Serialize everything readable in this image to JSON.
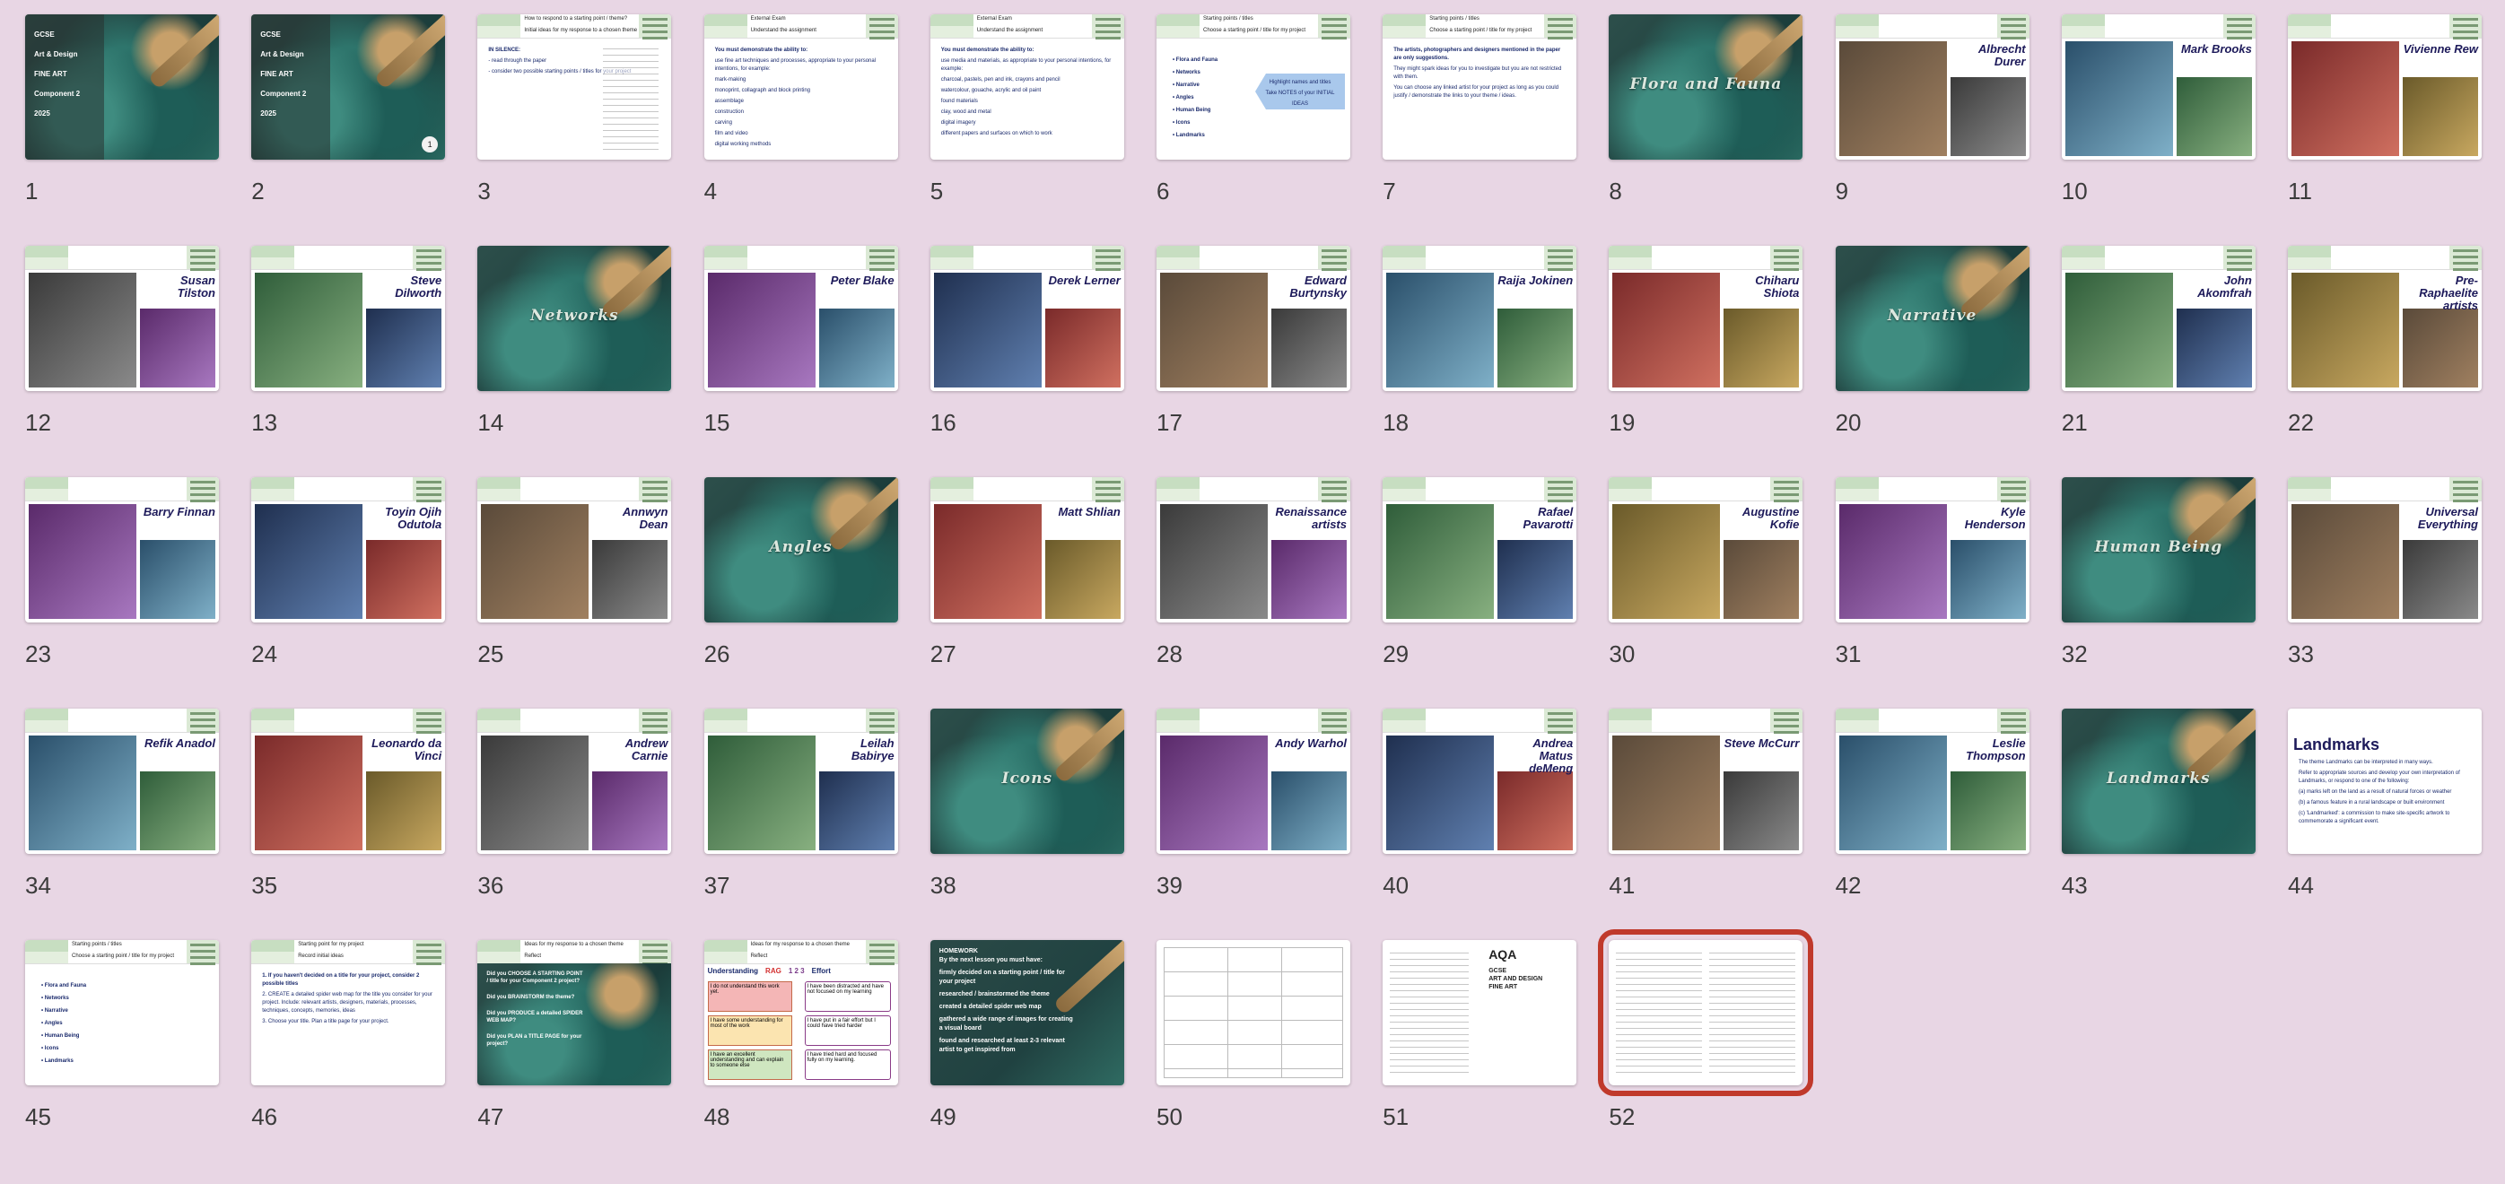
{
  "slides": [
    {
      "n": "1",
      "type": "cover-intro",
      "lines": [
        "GCSE",
        "Art & Design",
        "FINE ART",
        "Component 2",
        "2025"
      ]
    },
    {
      "n": "2",
      "type": "cover-intro",
      "lines": [
        "GCSE",
        "Art & Design",
        "FINE ART",
        "Component 2",
        "2025"
      ],
      "badge": "1"
    },
    {
      "n": "3",
      "type": "text",
      "header": [
        "How to respond to a starting point / theme?",
        "Initial ideas for my response to a chosen theme"
      ],
      "body": [
        "IN SILENCE:",
        "- read through the paper",
        "- consider two possible starting points / titles for your project"
      ]
    },
    {
      "n": "4",
      "type": "text",
      "header": [
        "External Exam",
        "Understand the assignment"
      ],
      "body": [
        "You must demonstrate the ability to:",
        "use fine art techniques and processes, appropriate to your personal intentions, for example:",
        "mark-making",
        "monoprint, collagraph and block printing",
        "assemblage",
        "construction",
        "carving",
        "film and video",
        "digital working methods"
      ]
    },
    {
      "n": "5",
      "type": "text",
      "header": [
        "External Exam",
        "Understand the assignment"
      ],
      "body": [
        "You must demonstrate the ability to:",
        "use media and materials, as appropriate to your personal intentions, for example:",
        "charcoal, pastels, pen and ink, crayons and pencil",
        "watercolour, gouache, acrylic and oil paint",
        "found materials",
        "clay, wood and metal",
        "digital imagery",
        "different papers and surfaces on which to work"
      ]
    },
    {
      "n": "6",
      "type": "list",
      "header": [
        "Starting points / titles",
        "Choose a starting point / title for my project"
      ],
      "items": [
        "Flora and Fauna",
        "Networks",
        "Narrative",
        "Angles",
        "Human Being",
        "Icons",
        "Landmarks"
      ],
      "callout": [
        "Highlight names and titles",
        "Take NOTES of your INITIAL IDEAS"
      ]
    },
    {
      "n": "7",
      "type": "text",
      "header": [
        "Starting points / titles",
        "Choose a starting point / title for my project"
      ],
      "body": [
        "The artists, photographers and designers mentioned in the paper are only suggestions.",
        "They might spark ideas for you to investigate but you are not restricted with them.",
        "You can choose any linked artist for your project as long as you could justify / demonstrate the links to your theme / ideas."
      ]
    },
    {
      "n": "8",
      "type": "cover",
      "title": "Flora and Fauna"
    },
    {
      "n": "9",
      "type": "artist",
      "artist": "Albrecht Durer"
    },
    {
      "n": "10",
      "type": "artist",
      "artist": "Mark Brooks"
    },
    {
      "n": "11",
      "type": "artist",
      "artist": "Vivienne Rew"
    },
    {
      "n": "12",
      "type": "artist",
      "artist": "Susan Tilston"
    },
    {
      "n": "13",
      "type": "artist",
      "artist": "Steve Dilworth"
    },
    {
      "n": "14",
      "type": "cover",
      "title": "Networks"
    },
    {
      "n": "15",
      "type": "artist",
      "artist": "Peter Blake"
    },
    {
      "n": "16",
      "type": "artist",
      "artist": "Derek Lerner"
    },
    {
      "n": "17",
      "type": "artist",
      "artist": "Edward Burtynsky"
    },
    {
      "n": "18",
      "type": "artist",
      "artist": "Raija Jokinen"
    },
    {
      "n": "19",
      "type": "artist",
      "artist": "Chiharu Shiota"
    },
    {
      "n": "20",
      "type": "cover",
      "title": "Narrative"
    },
    {
      "n": "21",
      "type": "artist",
      "artist": "John Akomfrah"
    },
    {
      "n": "22",
      "type": "artist",
      "artist": "Pre-Raphaelite artists"
    },
    {
      "n": "23",
      "type": "artist",
      "artist": "Barry Finnan"
    },
    {
      "n": "24",
      "type": "artist",
      "artist": "Toyin Ojih Odutola"
    },
    {
      "n": "25",
      "type": "artist",
      "artist": "Annwyn Dean"
    },
    {
      "n": "26",
      "type": "cover",
      "title": "Angles"
    },
    {
      "n": "27",
      "type": "artist",
      "artist": "Matt Shlian"
    },
    {
      "n": "28",
      "type": "artist",
      "artist": "Renaissance artists"
    },
    {
      "n": "29",
      "type": "artist",
      "artist": "Rafael Pavarotti"
    },
    {
      "n": "30",
      "type": "artist",
      "artist": "Augustine Kofie"
    },
    {
      "n": "31",
      "type": "artist",
      "artist": "Kyle Henderson"
    },
    {
      "n": "32",
      "type": "cover",
      "title": "Human Being"
    },
    {
      "n": "33",
      "type": "artist",
      "artist": "Universal Everything"
    },
    {
      "n": "34",
      "type": "artist",
      "artist": "Refik Anadol"
    },
    {
      "n": "35",
      "type": "artist",
      "artist": "Leonardo da Vinci"
    },
    {
      "n": "36",
      "type": "artist",
      "artist": "Andrew Carnie"
    },
    {
      "n": "37",
      "type": "artist",
      "artist": "Leilah Babirye"
    },
    {
      "n": "38",
      "type": "cover",
      "title": "Icons"
    },
    {
      "n": "39",
      "type": "artist",
      "artist": "Andy Warhol"
    },
    {
      "n": "40",
      "type": "artist",
      "artist": "Andrea Matus deMeng"
    },
    {
      "n": "41",
      "type": "artist",
      "artist": "Steve McCurr"
    },
    {
      "n": "42",
      "type": "artist",
      "artist": "Leslie Thompson"
    },
    {
      "n": "43",
      "type": "cover",
      "title": "Landmarks"
    },
    {
      "n": "44",
      "type": "landmarks",
      "title": "Landmarks",
      "body": [
        "The theme Landmarks can be interpreted in many ways.",
        "Refer to appropriate sources and develop your own interpretation of Landmarks, or respond to one of the following:",
        "(a) marks left on the land as a result of natural forces or weather",
        "(b) a famous feature in a rural landscape or built environment",
        "(c) 'Landmarked': a commission to make site-specific artwork to commemorate a significant event."
      ]
    },
    {
      "n": "45",
      "type": "list",
      "header": [
        "Starting points / titles",
        "Choose a starting point / title for my project"
      ],
      "items": [
        "Flora and Fauna",
        "Networks",
        "Narrative",
        "Angles",
        "Human Being",
        "Icons",
        "Landmarks"
      ]
    },
    {
      "n": "46",
      "type": "text",
      "header": [
        "Starting point for my project",
        "Record initial ideas"
      ],
      "body": [
        "1. If you haven't decided on a title for your project, consider 2 possible titles",
        "2. CREATE a detailed spider web map for the title you consider for your project. Include: relevant artists, designers, materials, processes, techniques, concepts, memories, ideas",
        "3. Choose your title. Plan a title page for your project."
      ]
    },
    {
      "n": "47",
      "type": "questions",
      "header": [
        "Ideas for my response to a chosen theme",
        "Reflect"
      ],
      "items": [
        "Did you CHOOSE A STARTING POINT / title for your Component 2 project?",
        "Did you BRAINSTORM the theme?",
        "Did you PRODUCE a detailed SPIDER WEB MAP?",
        "Did you PLAN a TITLE PAGE for your project?"
      ]
    },
    {
      "n": "48",
      "type": "rag",
      "header": [
        "Ideas for my response to a chosen theme",
        "Reflect"
      ],
      "heading": [
        "Understanding",
        "RAG",
        "1 2 3",
        "Effort"
      ],
      "left": [
        "I do not understand this work yet.",
        "I have some understanding for most of the work",
        "I have an excellent understanding and can explain to someone else"
      ],
      "right": [
        "I have been distracted and have not focused on my learning",
        "I have put in a fair effort but I could have tried harder",
        "I have tried hard and focused fully on my learning."
      ]
    },
    {
      "n": "49",
      "type": "homework",
      "title": "HOMEWORK",
      "lead": "By the next lesson you must have:",
      "items": [
        "firmly decided on a starting point / title for your project",
        "researched / brainstormed the theme",
        "created a detailed spider web map",
        "gathered a wide range of images for creating a visual board",
        "found and researched at least 2-3 relevant artist to get inspired from"
      ]
    },
    {
      "n": "50",
      "type": "table"
    },
    {
      "n": "51",
      "type": "aqa",
      "logo": "AQA",
      "lines": [
        "GCSE",
        "ART AND DESIGN",
        "FINE ART"
      ]
    },
    {
      "n": "52",
      "type": "doc",
      "selected": true
    }
  ],
  "colors": {
    "background": "#e8d6e4",
    "selected_outline": "#c0392b",
    "artist_text": "#1d1a5a",
    "body_text": "#1a2a6c"
  }
}
